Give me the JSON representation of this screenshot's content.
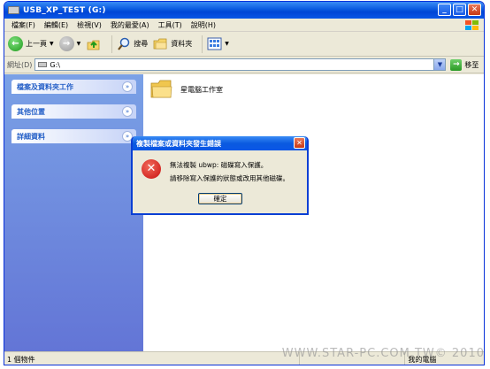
{
  "window": {
    "title": "USB_XP_TEST (G:)"
  },
  "menu": {
    "items": [
      "檔案(F)",
      "編輯(E)",
      "檢視(V)",
      "我的最愛(A)",
      "工具(T)",
      "說明(H)"
    ]
  },
  "toolbar": {
    "back_label": "上一頁",
    "search_label": "搜尋",
    "folders_label": "資料夾"
  },
  "address": {
    "label": "網址(D)",
    "value": "G:\\",
    "go_label": "移至"
  },
  "sidebar": {
    "panels": [
      {
        "label": "檔案及資料夾工作"
      },
      {
        "label": "其他位置"
      },
      {
        "label": "詳細資料"
      }
    ]
  },
  "content": {
    "folder_name": "星電腦工作室"
  },
  "status": {
    "count": "1 個物件",
    "zone": "我的電腦"
  },
  "dialog": {
    "title": "複製檔案或資料夾發生錯誤",
    "line1": "無法複製 ubwp: 磁碟寫入保護。",
    "line2": "請移除寫入保護的狀態或改用其他磁碟。",
    "ok_label": "確定"
  },
  "watermark": "WWW.STAR-PC.COM.TW© 2010"
}
